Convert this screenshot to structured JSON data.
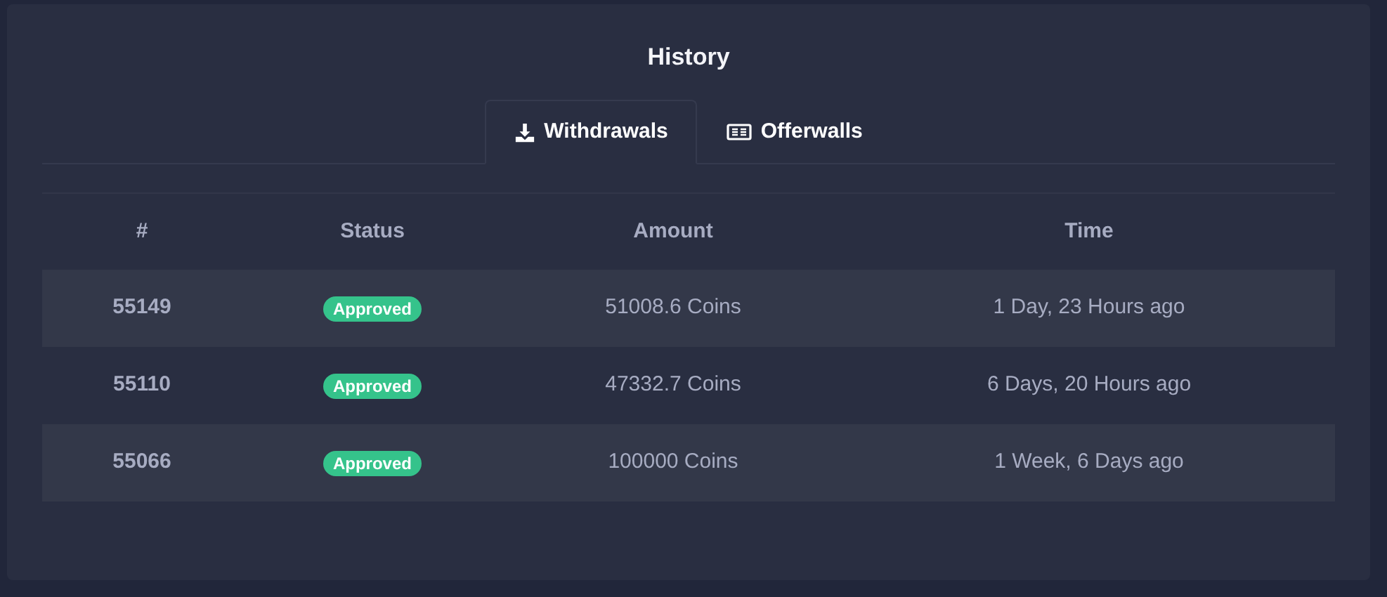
{
  "title": "History",
  "tabs": [
    {
      "label": "Withdrawals",
      "kind": "download",
      "selected": true
    },
    {
      "label": "Offerwalls",
      "kind": "ticket",
      "selected": false
    }
  ],
  "table": {
    "columns": [
      "#",
      "Status",
      "Amount",
      "Time"
    ],
    "rows": [
      {
        "id": "55149",
        "status": "Approved",
        "amount": "51008.6 Coins",
        "time": "1 Day, 23 Hours ago"
      },
      {
        "id": "55110",
        "status": "Approved",
        "amount": "47332.7 Coins",
        "time": "6 Days, 20 Hours ago"
      },
      {
        "id": "55066",
        "status": "Approved",
        "amount": "100000 Coins",
        "time": "1 Week, 6 Days ago"
      }
    ]
  }
}
